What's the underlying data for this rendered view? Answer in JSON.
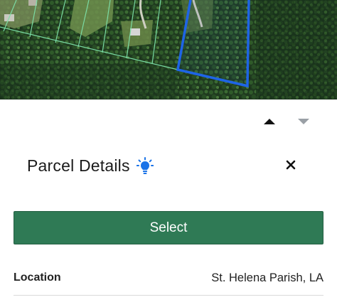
{
  "map": {
    "selected_parcel_color": "#1e64e6",
    "parcel_line_color": "#7de0a8"
  },
  "sheet_controls": {
    "expand_icon": "caret-up-icon",
    "collapse_icon": "caret-down-icon"
  },
  "panel": {
    "title": "Parcel Details",
    "title_icon": "lightbulb-icon",
    "close_icon": "close-icon",
    "select_label": "Select",
    "accent_color": "#2f7a55"
  },
  "details": [
    {
      "label": "Location",
      "value": "St. Helena Parish, LA"
    }
  ]
}
